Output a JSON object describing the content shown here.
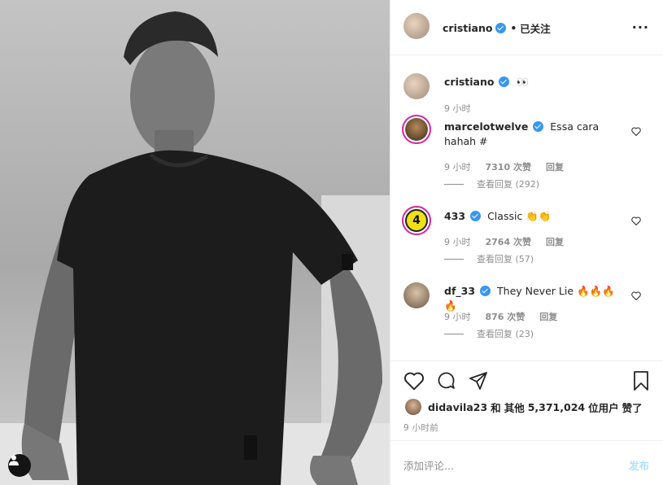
{
  "header": {
    "username": "cristiano",
    "follow_dot": "•",
    "follow_label": "已关注",
    "more_label": "···"
  },
  "caption": {
    "username": "cristiano",
    "text": "👀",
    "time": "9 小时"
  },
  "comments": [
    {
      "username": "marcelotwelve",
      "text": "Essa cara hahah #",
      "time": "9 小时",
      "likes": "7310 次赞",
      "reply": "回复",
      "view_replies": "查看回复 (292)"
    },
    {
      "username": "433",
      "text": "Classic 👏👏",
      "time": "9 小时",
      "likes": "2764 次赞",
      "reply": "回复",
      "view_replies": "查看回复 (57)",
      "avatar_text": "4"
    },
    {
      "username": "df_33",
      "text": "They Never Lie 🔥🔥🔥🔥",
      "time": "9 小时",
      "likes": "876 次赞",
      "reply": "回复",
      "view_replies": "查看回复 (23)"
    }
  ],
  "likes_line": {
    "user": "didavila23",
    "and": "和",
    "others": "其他",
    "count": "5,371,024",
    "suffix": "位用户",
    "liked": "赞了"
  },
  "posted_ago": "9 小时前",
  "add_comment": {
    "placeholder": "添加评论...",
    "post_label": "发布"
  },
  "icons": [
    "user-tag-icon",
    "verified-icon",
    "more-icon",
    "heart-icon",
    "comment-icon",
    "share-icon",
    "bookmark-icon"
  ],
  "colors": {
    "verified": "#3897f0",
    "muted": "#8e8e8e",
    "post_disabled": "#b2dffc"
  }
}
